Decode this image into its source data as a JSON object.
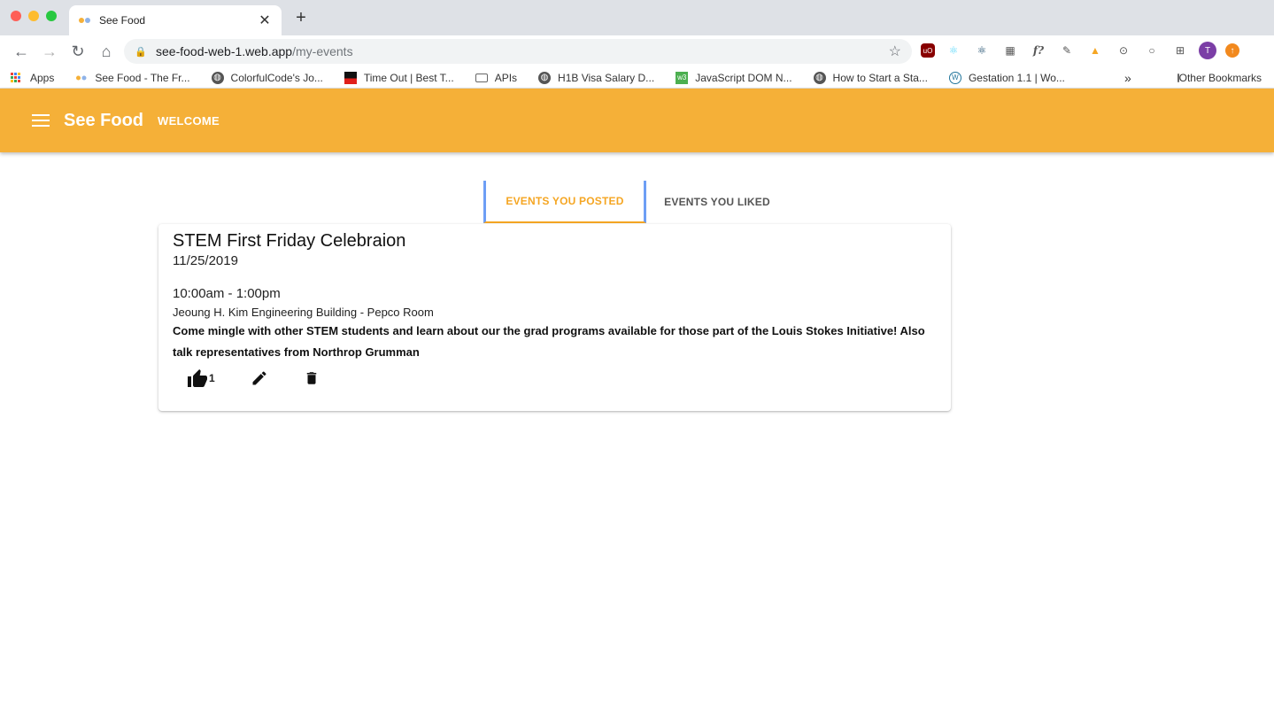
{
  "browser": {
    "tab_title": "See Food",
    "url_host": "see-food-web-1.web.app",
    "url_path": "/my-events",
    "bookmarks": [
      {
        "label": "Apps"
      },
      {
        "label": "See Food - The Fr..."
      },
      {
        "label": "ColorfulCode's Jo..."
      },
      {
        "label": "Time Out | Best T..."
      },
      {
        "label": "APIs"
      },
      {
        "label": "H1B Visa Salary D..."
      },
      {
        "label": "JavaScript DOM N..."
      },
      {
        "label": "How to Start a Sta..."
      },
      {
        "label": "Gestation 1.1 | Wo..."
      }
    ],
    "other_bookmarks": "Other Bookmarks",
    "avatar_initial": "T"
  },
  "appbar": {
    "brand": "See Food",
    "welcome": "WELCOME"
  },
  "tabs": {
    "posted": "EVENTS YOU POSTED",
    "liked": "EVENTS YOU LIKED"
  },
  "event": {
    "title": "STEM First Friday Celebraion",
    "date": "11/25/2019",
    "time": "10:00am - 1:00pm",
    "location": "Jeoung H. Kim Engineering Building - Pepco Room",
    "description": "Come mingle with other STEM students and learn about our the grad programs available for those part of the Louis Stokes Initiative! Also talk representatives from Northrop Grumman",
    "likes": "1"
  },
  "colors": {
    "appbar": "#f5b038",
    "active_tab": "#f5a623",
    "focus_outline": "#6d9ef5"
  }
}
